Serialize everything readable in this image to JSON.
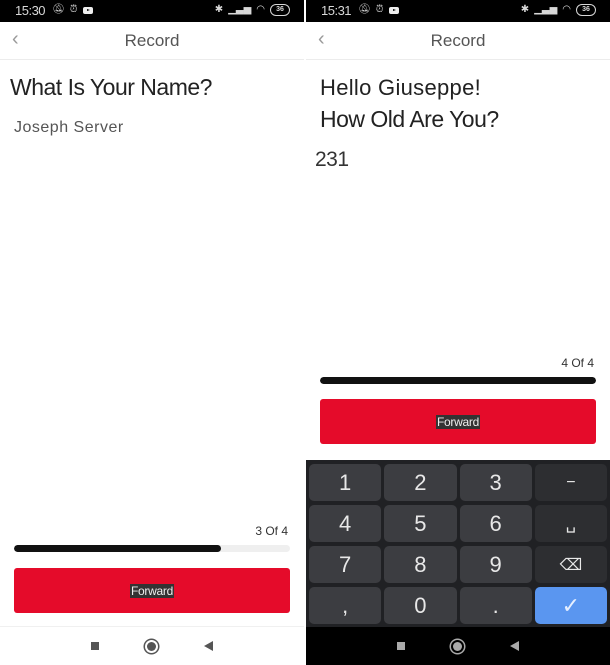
{
  "left": {
    "status": {
      "time": "15:30",
      "battery": "36"
    },
    "header": {
      "title": "Record",
      "back_icon": "chevron-left-icon"
    },
    "question": "What Is Your Name?",
    "answer_value": "Joseph Server",
    "progress": {
      "label": "3 Of 4",
      "current": 3,
      "total": 4,
      "fraction": 0.75
    },
    "forward_label": "Forward"
  },
  "right": {
    "status": {
      "time": "15:31",
      "battery": "36"
    },
    "header": {
      "title": "Record",
      "back_icon": "chevron-left-icon"
    },
    "greeting": "Hello Giuseppe!",
    "question": "How Old Are You?",
    "answer_value": "231",
    "progress": {
      "label": "4 Of 4",
      "current": 4,
      "total": 4,
      "fraction": 1.0
    },
    "forward_label": "Forward",
    "keyboard": {
      "keys": [
        {
          "label": "1",
          "type": "digit"
        },
        {
          "label": "2",
          "type": "digit"
        },
        {
          "label": "3",
          "type": "digit"
        },
        {
          "label": "−",
          "type": "fn",
          "name": "minus-key"
        },
        {
          "label": "4",
          "type": "digit"
        },
        {
          "label": "5",
          "type": "digit"
        },
        {
          "label": "6",
          "type": "digit"
        },
        {
          "label": "␣",
          "type": "fn",
          "name": "space-key"
        },
        {
          "label": "7",
          "type": "digit"
        },
        {
          "label": "8",
          "type": "digit"
        },
        {
          "label": "9",
          "type": "digit"
        },
        {
          "label": "⌫",
          "type": "fn",
          "name": "backspace-key"
        },
        {
          "label": ",",
          "type": "digit",
          "name": "comma-key"
        },
        {
          "label": "0",
          "type": "digit"
        },
        {
          "label": ".",
          "type": "digit",
          "name": "period-key"
        },
        {
          "label": "✓",
          "type": "enter",
          "name": "enter-key"
        }
      ]
    }
  },
  "colors": {
    "accent": "#e50b2a",
    "progress": "#111111",
    "enter_key": "#5a96f0"
  }
}
